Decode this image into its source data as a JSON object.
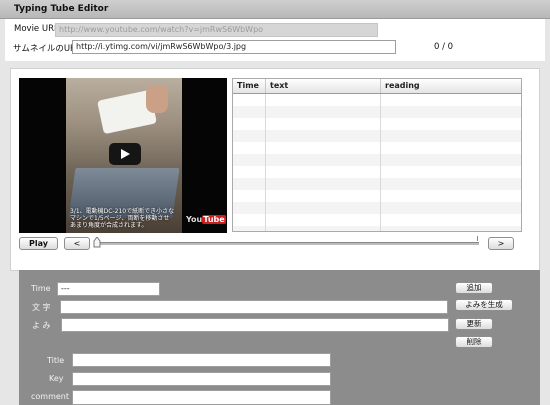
{
  "app": {
    "title": "Typing Tube Editor"
  },
  "form": {
    "movie_url_label": "Movie URL",
    "movie_url_value": "http://www.youtube.com/watch?v=jmRwS6WbWpo",
    "thumbnail_label": "サムネイルのURL",
    "thumbnail_value": "http://i.ytimg.com/vi/jmRwS6WbWpo/3.jpg",
    "counter": "0 / 0"
  },
  "video": {
    "subtitle_line1": "3/1、電動機DC-210で紙断でき小さな",
    "subtitle_line2": "マシンで1/5ページ、両断を移動させ",
    "subtitle_line3": "あまり角度が合成されます。",
    "logo_you": "You",
    "logo_tube": "Tube"
  },
  "table": {
    "columns": [
      "Time",
      "text",
      "reading"
    ],
    "row_count": 12
  },
  "controls": {
    "play_label": "Play",
    "prev_label": "<",
    "next_label": ">"
  },
  "editor": {
    "time_label": "Time",
    "time_value": "---",
    "text_label": "文 字",
    "reading_label": "よ み",
    "add_label": "追加",
    "generate_label": "よみを生成",
    "update_label": "更新",
    "delete_label": "削除",
    "title_label": "Title",
    "key_label": "Key",
    "comment_label": "comment"
  }
}
